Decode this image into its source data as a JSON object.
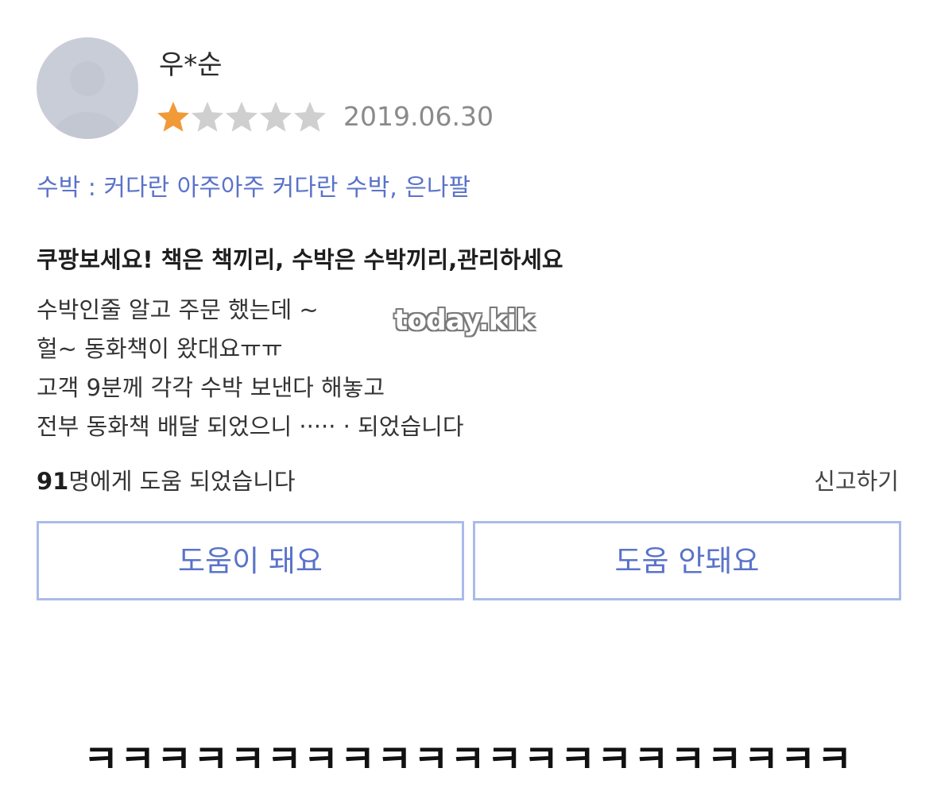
{
  "review": {
    "username": "우*순",
    "rating": 1,
    "rating_max": 5,
    "star_filled_color": "#f09a38",
    "star_empty_color": "#cfcfcf",
    "date": "2019.06.30",
    "option": "수박 : 커다란 아주아주 커다란 수박, 은나팔",
    "headline": "쿠팡보세요! 책은 책끼리, 수박은 수박끼리,관리하세요",
    "body_lines": [
      "수박인줄 알고 주문 했는데  ~",
      "헐~ 동화책이 왔대요ㅠㅠ",
      "고객 9분께 각각 수박 보낸다 해놓고",
      "전부 동화책 배달 되었으니 ·····  · 되었습니다"
    ],
    "helpful_count_number": "91",
    "helpful_count_suffix": "명에게 도움 되었습니다",
    "report_label": "신고하기",
    "helpful_button_label": "도움이 돼요",
    "not_helpful_button_label": "도움 안돼요",
    "accent_color": "#5a73c9"
  },
  "watermark": "today.kik",
  "caption": "ㅋㅋㅋㅋㅋㅋㅋㅋㅋㅋㅋㅋㅋㅋㅋㅋㅋㅋㅋㅋㅋ"
}
